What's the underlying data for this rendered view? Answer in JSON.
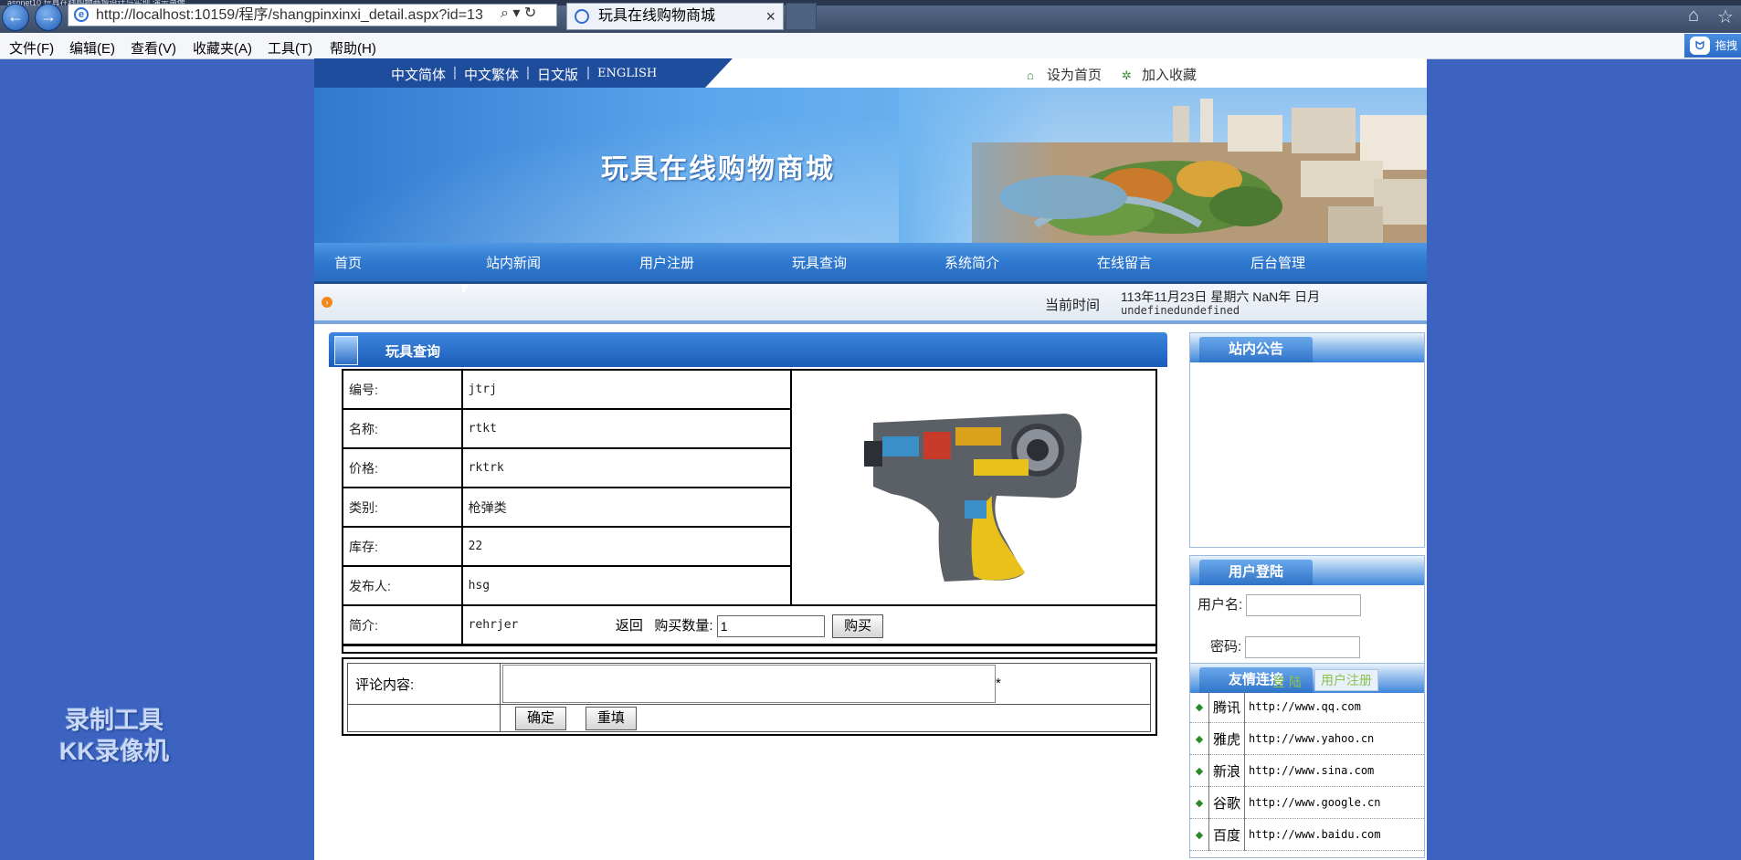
{
  "browser": {
    "title_strip": "aspnet10 玩具在线购物商城设计与实现 演示录像",
    "url": "http://localhost:10159/程序/shangpinxinxi_detail.aspx?id=13",
    "tab_title": "玩具在线购物商城",
    "menu": [
      "文件(F)",
      "编辑(E)",
      "查看(V)",
      "收藏夹(A)",
      "工具(T)",
      "帮助(H)"
    ],
    "baidu_label": "拖拽"
  },
  "site": {
    "languages": [
      "中文简体",
      "中文繁体",
      "日文版",
      "ENGLISH"
    ],
    "top_actions": [
      "设为首页",
      "加入收藏"
    ],
    "title": "玩具在线购物商城",
    "nav": [
      "首页",
      "站内新闻",
      "用户注册",
      "玩具查询",
      "系统简介",
      "在线留言",
      "后台管理"
    ],
    "current_time_label": "当前时间",
    "current_date": "113年11月23日 星期六 NaN年 日月",
    "current_undef": "undefinedundefined"
  },
  "main": {
    "section_title": "玩具查询",
    "fields": [
      {
        "label": "编号:",
        "value": "jtrj"
      },
      {
        "label": "名称:",
        "value": "rtkt"
      },
      {
        "label": "价格:",
        "value": "rktrk"
      },
      {
        "label": "类别:",
        "value": "枪弹类"
      },
      {
        "label": "库存:",
        "value": "22"
      },
      {
        "label": "发布人:",
        "value": "hsg"
      },
      {
        "label": "简介:",
        "value": "rehrjer"
      }
    ],
    "back_label": "返回",
    "qty_label": "购买数量:",
    "qty_value": "1",
    "buy_label": "购买",
    "comment_label": "评论内容:",
    "required_mark": "*",
    "confirm_label": "确定",
    "reset_label": "重填"
  },
  "sidebar": {
    "notice_title": "站内公告",
    "login_title": "用户登陆",
    "username_label": "用户名:",
    "password_label": "密码:",
    "login_button": "登 陆",
    "register_button": "用户注册",
    "links_title": "友情连接",
    "links": [
      {
        "name": "腾讯",
        "url": "http://www.qq.com"
      },
      {
        "name": "雅虎",
        "url": "http://www.yahoo.cn"
      },
      {
        "name": "新浪",
        "url": "http://www.sina.com"
      },
      {
        "name": "谷歌",
        "url": "http://www.google.cn"
      },
      {
        "name": "百度",
        "url": "http://www.baidu.com"
      }
    ]
  },
  "watermark": [
    "录制工具",
    "KK录像机"
  ],
  "colors": {
    "desktop": "#3c63c0",
    "nav": "#2e78cf",
    "accent_orange": "#f08a1c"
  }
}
